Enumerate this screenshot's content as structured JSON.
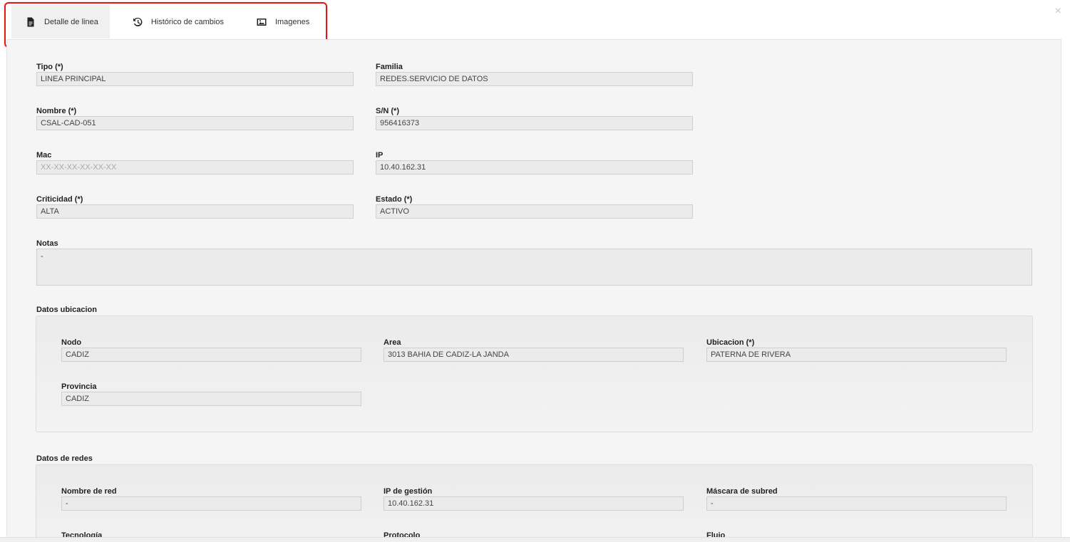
{
  "close_glyph": "×",
  "tabs": [
    {
      "label": "Detalle de linea",
      "icon": "document-icon",
      "active": true
    },
    {
      "label": "Histórico de cambios",
      "icon": "history-icon",
      "active": false
    },
    {
      "label": "Imagenes",
      "icon": "image-icon",
      "active": false
    }
  ],
  "fields": {
    "tipo": {
      "label": "Tipo (*)",
      "value": "LINEA PRINCIPAL"
    },
    "familia": {
      "label": "Familia",
      "value": "REDES.SERVICIO DE DATOS"
    },
    "nombre": {
      "label": "Nombre (*)",
      "value": "CSAL-CAD-051"
    },
    "sn": {
      "label": "S/N (*)",
      "value": "956416373"
    },
    "mac": {
      "label": "Mac",
      "value": "",
      "placeholder": "XX-XX-XX-XX-XX-XX"
    },
    "ip": {
      "label": "IP",
      "value": "10.40.162.31"
    },
    "criticidad": {
      "label": "Criticidad (*)",
      "value": "ALTA"
    },
    "estado": {
      "label": "Estado (*)",
      "value": "ACTIVO"
    },
    "notas": {
      "label": "Notas",
      "value": "-"
    }
  },
  "ubicacion": {
    "title": "Datos ubicacion",
    "nodo": {
      "label": "Nodo",
      "value": "CADIZ"
    },
    "area": {
      "label": "Area",
      "value": "3013 BAHIA DE CADIZ-LA JANDA"
    },
    "ubicacion": {
      "label": "Ubicacion (*)",
      "value": "PATERNA DE RIVERA"
    },
    "provincia": {
      "label": "Provincia",
      "value": "CADIZ"
    }
  },
  "redes": {
    "title": "Datos de redes",
    "nombre_red": {
      "label": "Nombre de red",
      "value": "-"
    },
    "ip_gestion": {
      "label": "IP de gestión",
      "value": "10.40.162.31"
    },
    "mascara": {
      "label": "Máscara de subred",
      "value": "-"
    },
    "tecnologia": {
      "label": "Tecnología"
    },
    "protocolo": {
      "label": "Protocolo"
    },
    "flujo": {
      "label": "Flujo"
    }
  }
}
